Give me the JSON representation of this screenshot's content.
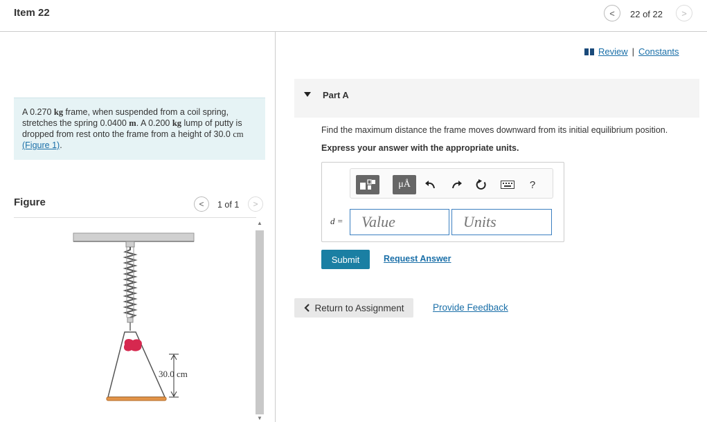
{
  "header": {
    "item_title": "Item 22",
    "prev_glyph": "<",
    "next_glyph": ">",
    "item_counter": "22 of 22"
  },
  "problem": {
    "text_a": "A 0.270 ",
    "unit_kg": "kg",
    "text_b": " frame, when suspended from a coil spring, stretches the spring 0.0400 ",
    "unit_m": "m",
    "text_c": ". A 0.200 ",
    "unit_kg2": "kg",
    "text_d": " lump of putty is dropped from rest onto the frame from a height of 30.0 ",
    "unit_cm": "cm",
    "text_e": " ",
    "figure_link": "(Figure 1)",
    "text_f": "."
  },
  "figure_panel": {
    "label": "Figure",
    "counter": "1 of 1",
    "prev_glyph": "<",
    "next_glyph": ">",
    "dimension_label": "30.0 cm",
    "colors": {
      "putty": "#d6284f",
      "frame_base": "#e3954a",
      "ceiling": "#bfbfbf"
    }
  },
  "links": {
    "review": "Review",
    "separator": "|",
    "constants": "Constants"
  },
  "part": {
    "title": "Part A",
    "question": "Find the maximum distance the frame moves downward from its initial equilibrium position.",
    "instruction": "Express your answer with the appropriate units."
  },
  "answer": {
    "variable_label": "d =",
    "value_placeholder": "Value",
    "units_placeholder": "Units",
    "toolbar_units_glyph": "μÅ",
    "toolbar_help_glyph": "?"
  },
  "actions": {
    "submit": "Submit",
    "request_answer": "Request Answer",
    "return": "Return to Assignment",
    "feedback": "Provide Feedback"
  },
  "colors": {
    "accent": "#1a7fa3",
    "link": "#1a6fa8",
    "problem_bg": "#e6f3f5",
    "input_border": "#3a7fc0"
  }
}
